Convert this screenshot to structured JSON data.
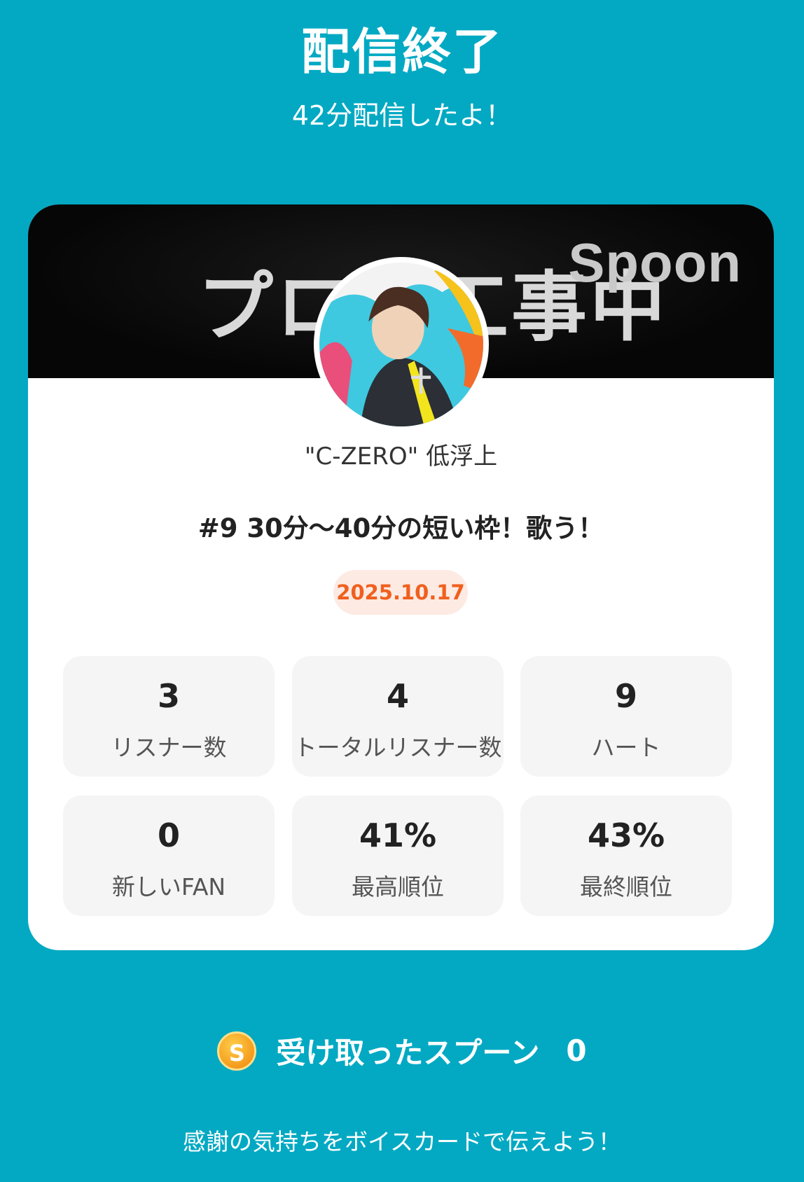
{
  "header": {
    "title": "配信終了",
    "subtitle": "42分配信したよ！"
  },
  "card": {
    "banner_text": "プロフ工事中",
    "banner_logo": "Spoon",
    "username": "\"C-ZERO\" 低浮上",
    "live_title": "#9 30分〜40分の短い枠！歌う！",
    "date": "2025.10.17",
    "stats": [
      {
        "value": "3",
        "label": "リスナー数"
      },
      {
        "value": "4",
        "label": "トータルリスナー数"
      },
      {
        "value": "9",
        "label": "ハート"
      },
      {
        "value": "0",
        "label": "新しいFAN"
      },
      {
        "value": "41%",
        "label": "最高順位"
      },
      {
        "value": "43%",
        "label": "最終順位"
      }
    ]
  },
  "spoons": {
    "icon_letter": "S",
    "label": "受け取ったスプーン",
    "count": "0"
  },
  "footer": {
    "message": "感謝の気持ちをボイスカードで伝えよう！"
  },
  "colors": {
    "background": "#03a9c3",
    "date_text": "#f0601e",
    "date_bg": "#fdeae3"
  }
}
